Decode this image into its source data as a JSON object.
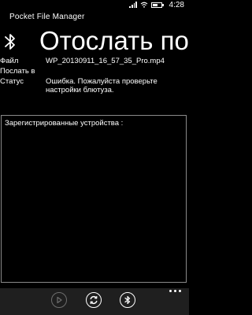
{
  "status_bar": {
    "time": "4:28",
    "icons": [
      "signal-icon",
      "wifi-icon",
      "battery-icon"
    ],
    "battery_level": 0.6
  },
  "app": {
    "title": "Pocket File Manager",
    "header_icon": "bluetooth-icon",
    "page_title": "Отослать по"
  },
  "info": {
    "file_label": "Файл",
    "file_value": "WP_20130911_16_57_35_Pro.mp4",
    "send_to_label": "Послать в",
    "send_to_value": "",
    "status_label": "Статус",
    "status_value": "Ошибка. Пожалуйста проверьте настройки блютуза."
  },
  "devices": {
    "label": "Зарегистрированные устройства :",
    "items": []
  },
  "app_bar": {
    "buttons": [
      {
        "icon": "play-icon",
        "enabled": false
      },
      {
        "icon": "refresh-icon",
        "enabled": true
      },
      {
        "icon": "bluetooth-icon",
        "enabled": true
      }
    ],
    "more_icon": "more-dots-icon"
  },
  "colors": {
    "background": "#000000",
    "foreground": "#ffffff",
    "panel_border": "#8a8a8a",
    "app_bar": "#1f1f1f",
    "disabled": "#6d6d6d"
  }
}
